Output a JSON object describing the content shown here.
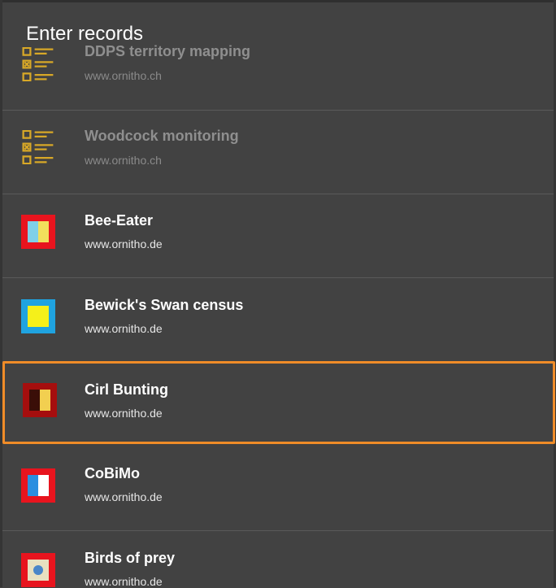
{
  "title": "Enter records",
  "items": [
    {
      "name": "DDPS territory mapping",
      "url": "www.ornitho.ch",
      "icon": "checklist-icon",
      "enabled": false
    },
    {
      "name": "Woodcock monitoring",
      "url": "www.ornitho.ch",
      "icon": "checklist-icon",
      "enabled": false
    },
    {
      "name": "Bee-Eater",
      "url": "www.ornitho.de",
      "icon": "flag-red-yellow-icon",
      "enabled": true
    },
    {
      "name": "Bewick's Swan census",
      "url": "www.ornitho.de",
      "icon": "flag-blue-yellow-icon",
      "enabled": true
    },
    {
      "name": "Cirl Bunting",
      "url": "www.ornitho.de",
      "icon": "flag-darkred-yellow-icon",
      "enabled": true,
      "selected": true
    },
    {
      "name": "CoBiMo",
      "url": "www.ornitho.de",
      "icon": "flag-red-white-blue-icon",
      "enabled": true
    },
    {
      "name": "Birds of prey",
      "url": "www.ornitho.de",
      "icon": "flag-red-blue-dot-icon",
      "enabled": true
    }
  ],
  "colors": {
    "selected_border": "#f08c28",
    "checklist": "#d8a827"
  }
}
